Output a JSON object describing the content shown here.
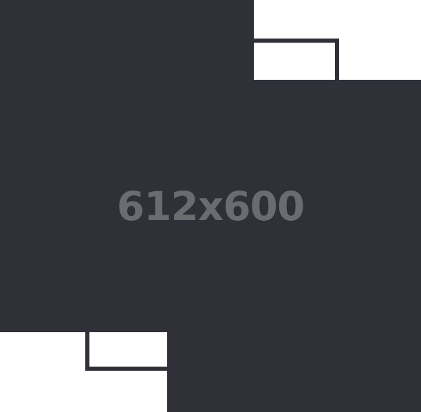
{
  "placeholder": {
    "label": "612x600",
    "background_color": "#ffffff",
    "shape_color": "#2f3038",
    "text_color": "#6b6c70"
  }
}
